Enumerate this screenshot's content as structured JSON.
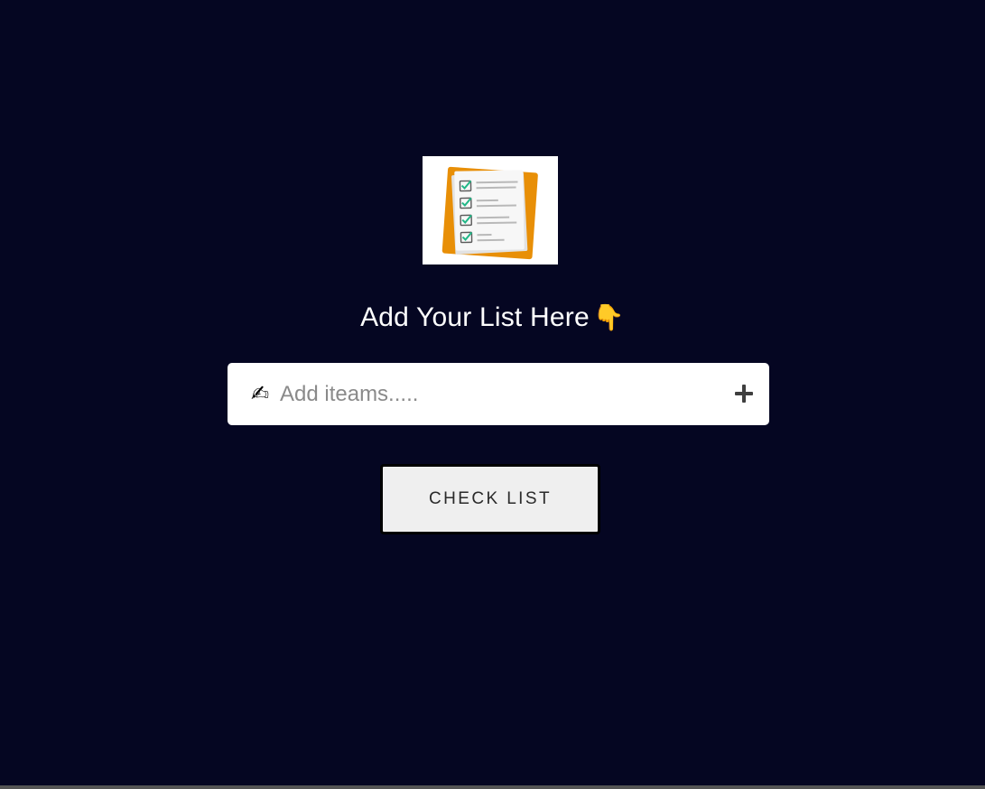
{
  "logo": {
    "icon": "checklist-clipboard-icon",
    "colors": {
      "paper_back": "#e88f07",
      "paper": "#f5f5f5",
      "check": "#21b787",
      "lines": "#b9b9b9"
    }
  },
  "heading": {
    "text": "Add Your List Here",
    "emoji": "👇"
  },
  "input": {
    "emoji": "✍",
    "placeholder": "Add iteams.....",
    "value": ""
  },
  "add_button": {
    "icon": "plus-icon"
  },
  "check_button": {
    "label": "CHECK LIST"
  },
  "colors": {
    "background": "#050622",
    "input_background": "#ffffff",
    "button_background": "#efefef"
  }
}
